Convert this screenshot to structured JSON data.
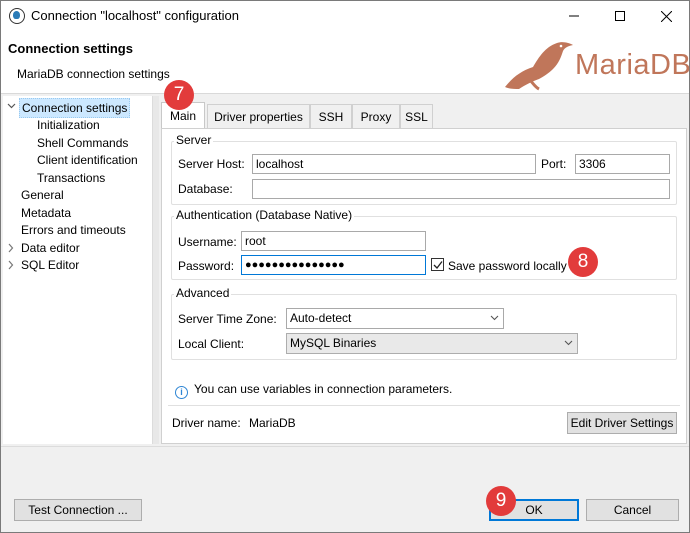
{
  "window": {
    "title": "Connection \"localhost\" configuration"
  },
  "header": {
    "title": "Connection settings",
    "subtitle": "MariaDB connection settings",
    "logo_text": "MariaDB",
    "logo_color": "#c0765a"
  },
  "nav": {
    "items": [
      {
        "label": "Connection settings",
        "expanded": true,
        "selected": true
      },
      {
        "label": "Initialization"
      },
      {
        "label": "Shell Commands"
      },
      {
        "label": "Client identification"
      },
      {
        "label": "Transactions"
      },
      {
        "label": "General"
      },
      {
        "label": "Metadata"
      },
      {
        "label": "Errors and timeouts"
      },
      {
        "label": "Data editor",
        "collapsed": true
      },
      {
        "label": "SQL Editor",
        "collapsed": true
      }
    ]
  },
  "tabs": [
    {
      "label": "Main",
      "active": true
    },
    {
      "label": "Driver properties"
    },
    {
      "label": "SSH"
    },
    {
      "label": "Proxy"
    },
    {
      "label": "SSL"
    }
  ],
  "server": {
    "group_title": "Server",
    "host_label": "Server Host:",
    "host_value": "localhost",
    "port_label": "Port:",
    "port_value": "3306",
    "database_label": "Database:",
    "database_value": ""
  },
  "auth": {
    "group_title": "Authentication (Database Native)",
    "username_label": "Username:",
    "username_value": "root",
    "password_label": "Password:",
    "password_value": "●●●●●●●●●●●●●●●",
    "save_password_label": "Save password locally",
    "save_password_checked": true
  },
  "advanced": {
    "group_title": "Advanced",
    "timezone_label": "Server Time Zone:",
    "timezone_value": "Auto-detect",
    "client_label": "Local Client:",
    "client_value": "MySQL Binaries"
  },
  "info_text": "You can use variables in connection parameters.",
  "driver": {
    "label": "Driver name:",
    "value": "MariaDB",
    "edit_button": "Edit Driver Settings"
  },
  "footer": {
    "test_button": "Test Connection ...",
    "ok_button": "OK",
    "cancel_button": "Cancel"
  },
  "badges": {
    "tabs_step": "7",
    "password_step": "8",
    "ok_step": "9",
    "color": "#e23b3b"
  }
}
